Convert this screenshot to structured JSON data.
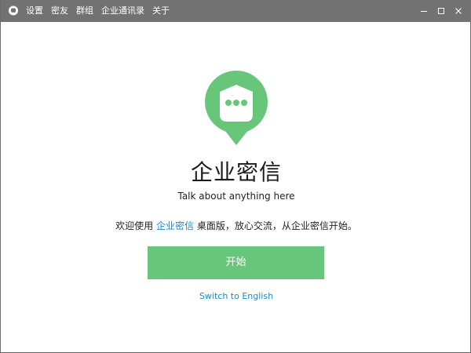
{
  "titlebar": {
    "menu": [
      {
        "label": "设置"
      },
      {
        "label": "密友"
      },
      {
        "label": "群组"
      },
      {
        "label": "企业通讯录"
      },
      {
        "label": "关于"
      }
    ]
  },
  "main": {
    "title": "企业密信",
    "slogan": "Talk about anything here",
    "welcome": {
      "prefix": "欢迎使用 ",
      "link": "企业密信",
      "suffix": " 桌面版，放心交流，从企业密信开始。"
    },
    "start_button": "开始",
    "switch_language": "Switch to English"
  },
  "colors": {
    "titlebar_bg": "#727272",
    "brand_green": "#68c67b",
    "link_blue": "#1b8ac7"
  },
  "icons": {
    "app": "chat-bubble-icon",
    "logo": "chat-bubble-dots-icon",
    "minimize": "minimize-icon",
    "maximize": "maximize-icon",
    "close": "close-icon"
  }
}
